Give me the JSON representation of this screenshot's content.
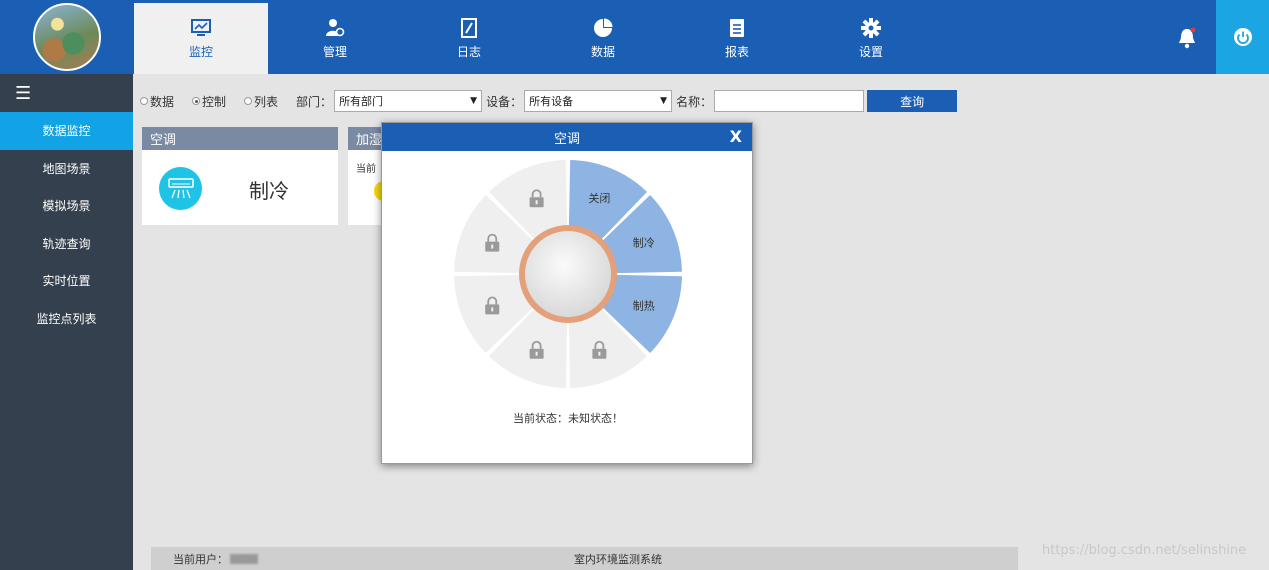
{
  "nav": {
    "items": [
      {
        "label": "监控",
        "icon": "monitor-chart-icon"
      },
      {
        "label": "管理",
        "icon": "user-gear-icon"
      },
      {
        "label": "日志",
        "icon": "notebook-icon"
      },
      {
        "label": "数据",
        "icon": "pie-chart-icon"
      },
      {
        "label": "报表",
        "icon": "document-list-icon"
      },
      {
        "label": "设置",
        "icon": "gear-icon"
      }
    ],
    "active_index": 0
  },
  "sidebar": {
    "items": [
      {
        "label": "数据监控"
      },
      {
        "label": "地图场景"
      },
      {
        "label": "模拟场景"
      },
      {
        "label": "轨迹查询"
      },
      {
        "label": "实时位置"
      },
      {
        "label": "监控点列表"
      }
    ],
    "active_index": 0
  },
  "filter": {
    "radios": [
      {
        "label": "数据",
        "checked": false
      },
      {
        "label": "控制",
        "checked": true
      },
      {
        "label": "列表",
        "checked": false
      }
    ],
    "dept_label": "部门：",
    "dept_value": "所有部门",
    "device_label": "设备：",
    "device_value": "所有设备",
    "name_label": "名称：",
    "name_value": "",
    "query_label": "查询"
  },
  "cards": [
    {
      "title": "空调",
      "status": "制冷"
    },
    {
      "title": "加湿",
      "partial_text": "当前"
    }
  ],
  "modal": {
    "title": "空调",
    "close_label": "X",
    "segments": [
      {
        "label": "关闭",
        "enabled": true
      },
      {
        "label": "制冷",
        "enabled": true
      },
      {
        "label": "制热",
        "enabled": true
      },
      {
        "label": "",
        "enabled": false
      },
      {
        "label": "",
        "enabled": false
      },
      {
        "label": "",
        "enabled": false
      },
      {
        "label": "",
        "enabled": false
      },
      {
        "label": "",
        "enabled": false
      }
    ],
    "status_text": "当前状态：未知状态！"
  },
  "footer": {
    "user_label": "当前用户：",
    "system_name": "室内环境监测系统"
  },
  "watermark": "https://blog.csdn.net/selinshine",
  "colors": {
    "primary": "#1a5fb4",
    "accent": "#11a3e6",
    "segment_enabled": "#8db4e2",
    "segment_disabled": "#efefef",
    "ring": "#e3a07a"
  }
}
